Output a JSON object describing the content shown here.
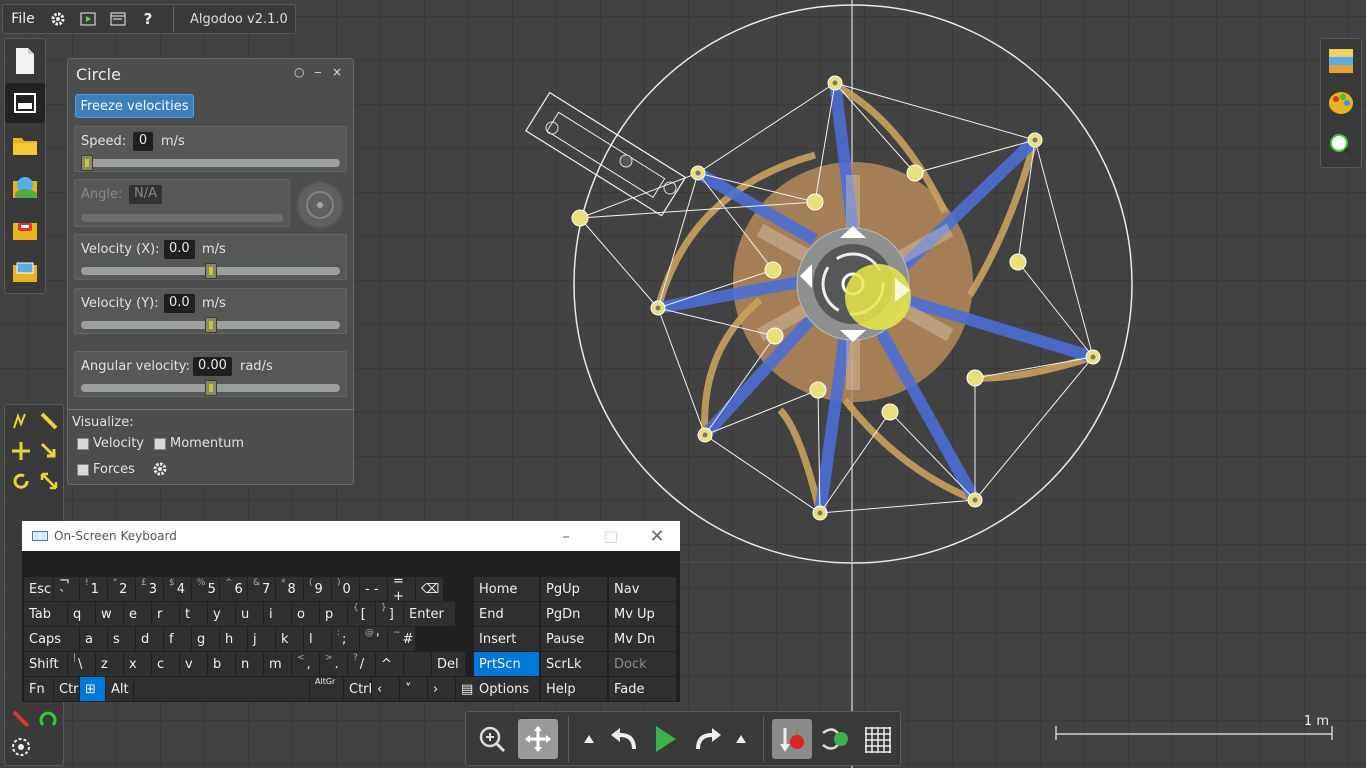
{
  "app": {
    "title": "Algodoo v2.1.0"
  },
  "topbar": {
    "file_label": "File"
  },
  "panel": {
    "title": "Circle",
    "freeze_label": "Freeze velocities",
    "speed": {
      "label": "Speed:",
      "value": "0",
      "unit": "m/s",
      "slider": 0.0
    },
    "angle": {
      "label": "Angle:",
      "value": "N/A"
    },
    "vel_x": {
      "label": "Velocity (X):",
      "value": "0.0",
      "unit": "m/s",
      "slider": 0.5
    },
    "vel_y": {
      "label": "Velocity (Y):",
      "value": "0.0",
      "unit": "m/s",
      "slider": 0.5
    },
    "ang_vel": {
      "label": "Angular velocity:",
      "value": "0.00",
      "unit": "rad/s",
      "slider": 0.5
    },
    "visualize_label": "Visualize:",
    "velocity_label": "Velocity",
    "momentum_label": "Momentum",
    "forces_label": "Forces"
  },
  "keyboard": {
    "title": "On-Screen Keyboard",
    "rows": [
      [
        [
          "Esc",
          ""
        ],
        [
          "¬ `",
          ""
        ],
        [
          "1",
          "!"
        ],
        [
          "2",
          "\""
        ],
        [
          "3",
          "£"
        ],
        [
          "4",
          "$"
        ],
        [
          "5",
          "%"
        ],
        [
          "6",
          "^"
        ],
        [
          "7",
          "&"
        ],
        [
          "8",
          "*"
        ],
        [
          "9",
          "("
        ],
        [
          "0",
          ")"
        ],
        [
          "- -",
          ""
        ],
        [
          "= +",
          ""
        ],
        [
          "⌫",
          ""
        ]
      ],
      [
        [
          "Tab",
          ""
        ],
        [
          "q",
          ""
        ],
        [
          "w",
          ""
        ],
        [
          "e",
          ""
        ],
        [
          "r",
          ""
        ],
        [
          "t",
          ""
        ],
        [
          "y",
          ""
        ],
        [
          "u",
          ""
        ],
        [
          "i",
          ""
        ],
        [
          "o",
          ""
        ],
        [
          "p",
          ""
        ],
        [
          "[",
          "{"
        ],
        [
          "]",
          "}"
        ],
        [
          "Enter",
          ""
        ]
      ],
      [
        [
          "Caps",
          ""
        ],
        [
          "a",
          ""
        ],
        [
          "s",
          ""
        ],
        [
          "d",
          ""
        ],
        [
          "f",
          ""
        ],
        [
          "g",
          ""
        ],
        [
          "h",
          ""
        ],
        [
          "j",
          ""
        ],
        [
          "k",
          ""
        ],
        [
          "l",
          ""
        ],
        [
          ";",
          ":"
        ],
        [
          "'",
          "@"
        ],
        [
          "#",
          "~"
        ]
      ],
      [
        [
          "Shift",
          ""
        ],
        [
          "\\",
          "|"
        ],
        [
          "z",
          ""
        ],
        [
          "x",
          ""
        ],
        [
          "c",
          ""
        ],
        [
          "v",
          ""
        ],
        [
          "b",
          ""
        ],
        [
          "n",
          ""
        ],
        [
          "m",
          ""
        ],
        [
          ",",
          "<"
        ],
        [
          ".",
          ">"
        ],
        [
          "/",
          "?"
        ],
        [
          "^",
          ""
        ],
        [
          "",
          ""
        ],
        [
          "Del",
          ""
        ]
      ],
      [
        [
          "Fn",
          ""
        ],
        [
          "Ctrl",
          ""
        ],
        [
          "⊞",
          ""
        ],
        [
          "Alt",
          ""
        ],
        [
          "",
          ""
        ],
        [
          "AltGr",
          ""
        ],
        [
          "Ctrl",
          ""
        ],
        [
          "‹",
          ""
        ],
        [
          "˅",
          ""
        ],
        [
          "›",
          ""
        ],
        [
          "▤",
          ""
        ]
      ]
    ],
    "nav_keys": [
      [
        "Home",
        "PgUp",
        "Nav"
      ],
      [
        "End",
        "PgDn",
        "Mv Up"
      ],
      [
        "Insert",
        "Pause",
        "Mv Dn"
      ],
      [
        "PrtScn",
        "ScrLk",
        "Dock"
      ],
      [
        "Options",
        "Help",
        "Fade"
      ]
    ],
    "active_key": "PrtScn",
    "disabled_key": "Dock",
    "shift_small": "Shift"
  },
  "scale": {
    "label": "1 m"
  },
  "colors": {
    "accent": "#3b83c0",
    "key_active": "#0078d7",
    "star_blue": "#4a6fd8",
    "ring_tan": "#c9a25d",
    "yellow": "#e8e84a"
  }
}
